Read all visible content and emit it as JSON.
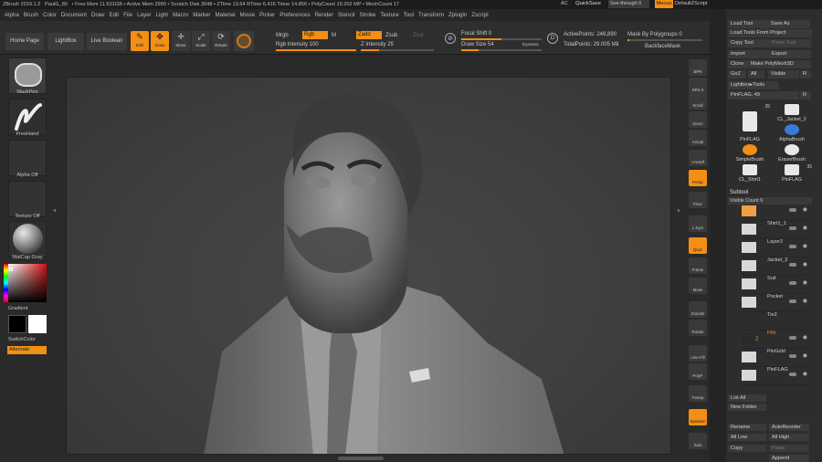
{
  "titlebar": {
    "app": "ZBrush 2019.1.2",
    "doc": "PaulG_80",
    "stats": "• Free Mem 11.631GB • Active Mem 2990 • Scratch Disk 3048 • ZTime 13.64 RTime 6.416 Timer 14.856 • PolyCount 19.202 MP • MeshCount 17",
    "ac": "AC",
    "quicksave": "QuickSave",
    "seethrough": "See-through 0",
    "menus": "Menus",
    "script": "DefaultZScript"
  },
  "menubar": [
    "Alpha",
    "Brush",
    "Color",
    "Document",
    "Draw",
    "Edit",
    "File",
    "Layer",
    "Light",
    "Macro",
    "Marker",
    "Material",
    "Movie",
    "Picker",
    "Preferences",
    "Render",
    "Stencil",
    "Stroke",
    "Texture",
    "Tool",
    "Transform",
    "Zplugin",
    "Zscript"
  ],
  "toolbar": {
    "home": "Home Page",
    "lightbox": "LightBox",
    "liveboolean": "Live Boolean",
    "edit": "Edit",
    "draw": "Draw",
    "move": "Move",
    "scale": "Scale",
    "rotate": "Rotate",
    "mrgb": "Mrgb",
    "rgb": "Rgb",
    "m": "M",
    "zadd": "Zadd",
    "zsub": "Zsub",
    "zcut": "Zcut",
    "rgb_intensity": "Rgb Intensity 100",
    "z_intensity": "Z Intensity 25",
    "focal_shift": "Focal Shift 0",
    "draw_size": "Draw Size 54",
    "dynamic": "Dynamic",
    "active_points": "ActivePoints: 249,890",
    "total_points": "TotalPoints: 29.005 Mil",
    "mask_by_polygroups": "Mask By Polygroups 0",
    "backface_mask": "BackfaceMask"
  },
  "leftshelf": {
    "brush": "MaskPen",
    "stroke": "FreeHand",
    "alpha": "Alpha Off",
    "texture": "Texture Off",
    "material": "MatCap Gray",
    "gradient": "Gradient",
    "switchcolor": "SwitchColor",
    "alternate": "Alternate"
  },
  "rightshelf": [
    "BPR",
    "SPix 3",
    "Scroll",
    "Zoom",
    "Actual",
    "AAHalf",
    "Persp",
    "Floor",
    "L.Sym",
    "Qxyz",
    "Frame",
    "Move",
    "ZoomD",
    "Rotate",
    "Line Fill",
    "PolyF",
    "Transp",
    "Dynamic",
    "Solo"
  ],
  "panel": {
    "load_tool": "Load Tool",
    "save_as": "Save As",
    "load_tools_from_project": "Load Tools From Project",
    "copy_tool": "Copy Tool",
    "paste_tool": "Paste Tool",
    "import": "Import",
    "export": "Export",
    "clone": "Clone",
    "make_polymesh": "Make PolyMesh3D",
    "goz": "GoZ",
    "all": "All",
    "visible": "Visible",
    "r": "R",
    "lightbox_tools": "Lightbox▸Tools",
    "pinflag": "PinFLAG. 49",
    "tools": [
      {
        "name": "PinFLAG",
        "count": "35"
      },
      {
        "name": "CL_Jacket_2",
        "count": ""
      },
      {
        "name": "AlphaBrush",
        "count": ""
      },
      {
        "name": "SimpleBrush",
        "count": ""
      },
      {
        "name": "EraserBrush",
        "count": ""
      },
      {
        "name": "CL_Shirt1",
        "count": ""
      },
      {
        "name": "PinFLAG",
        "count": "35"
      }
    ],
    "subtool": "Subtool",
    "visible_count": "Visible Count 9",
    "subtools": [
      "Shirt1_1",
      "Layer2",
      "Jacket_3",
      "Suit",
      "Pocket",
      "Tie2",
      "PIN",
      "PinGold",
      "PinFLAG"
    ],
    "pin_num": "2",
    "list_all": "List All",
    "new_folder": "New Folder",
    "rename": "Rename",
    "autoreorder": "AutoReorder",
    "all_low": "All Low",
    "all_high": "All High",
    "copy": "Copy",
    "paste": "Paste",
    "append": "Append"
  },
  "colors": {
    "accent": "#f28f14",
    "bg": "#2a2a2a",
    "canvas": "#404040"
  }
}
